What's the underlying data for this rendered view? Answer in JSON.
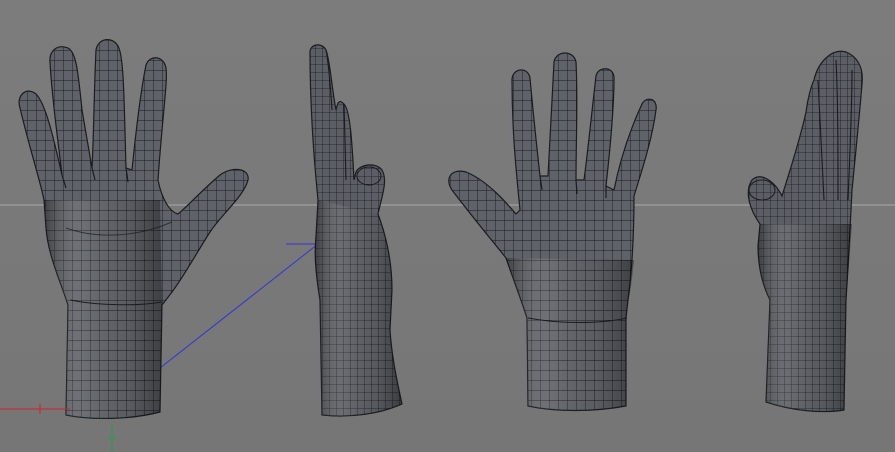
{
  "viewport": {
    "background": "#7a7a7a",
    "horizon_color": "#a8a8a8",
    "axis_x_color": "#d0202a",
    "axis_y_color": "#22a04a",
    "axis_z_color": "#3030d0"
  },
  "models": [
    {
      "id": "hand-front",
      "view": "front"
    },
    {
      "id": "hand-side-left",
      "view": "side"
    },
    {
      "id": "hand-back",
      "view": "back"
    },
    {
      "id": "hand-side-right",
      "view": "side"
    }
  ],
  "mesh": {
    "surface_color": "#5e6167",
    "wire_color": "#16181c"
  }
}
